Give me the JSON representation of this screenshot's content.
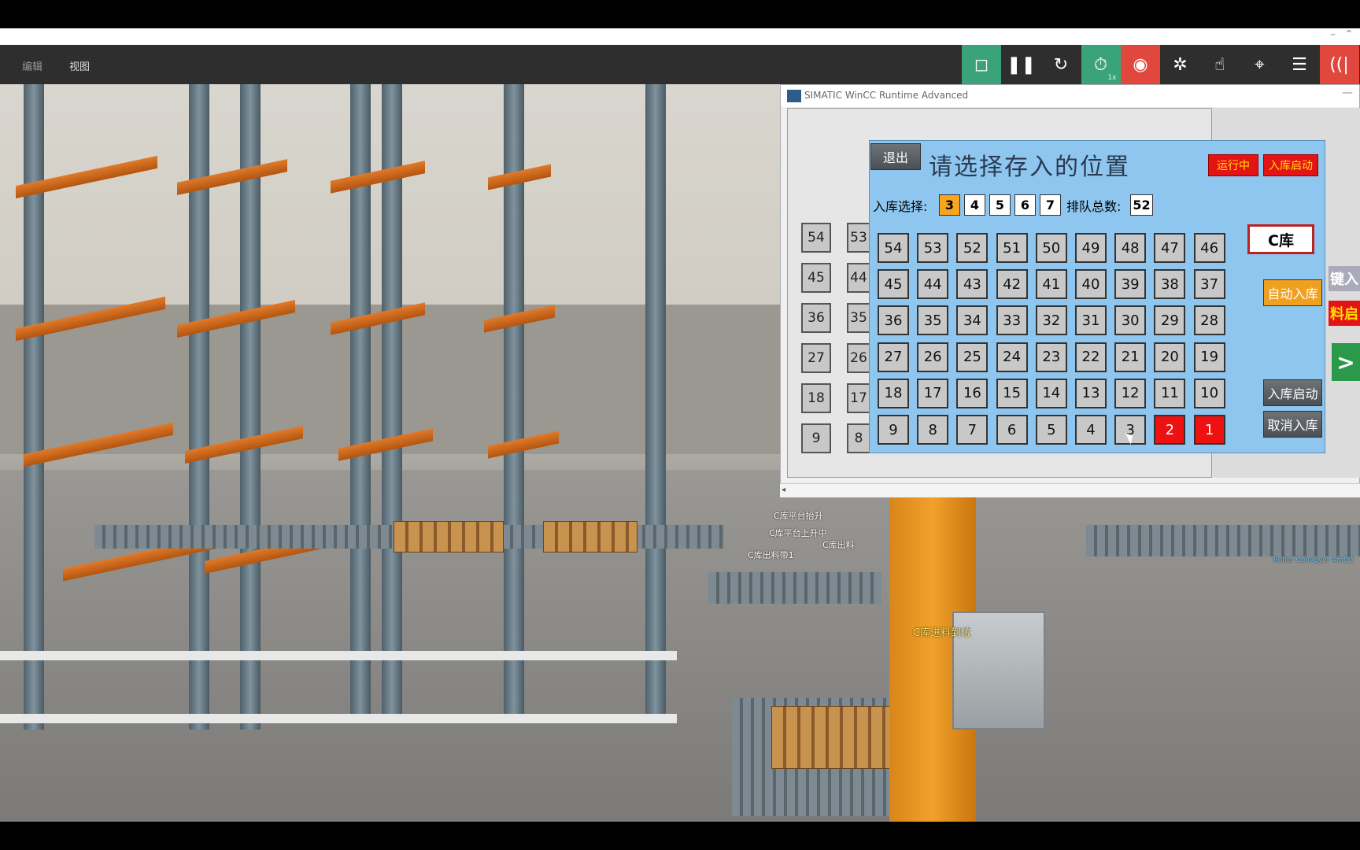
{
  "menu": {
    "edit": "编辑",
    "view": "视图"
  },
  "strip": {
    "minimize": "–",
    "collapse": "⌃"
  },
  "toolbar": {
    "buttons": [
      {
        "name": "stop",
        "glyph": "◻",
        "color": "#3aa37a"
      },
      {
        "name": "pause",
        "glyph": "❚❚",
        "color": "#2e2e2e"
      },
      {
        "name": "reset",
        "glyph": "↻",
        "color": "#2e2e2e"
      },
      {
        "name": "timer",
        "glyph": "⏱",
        "color": "#3aa37a",
        "sub": "1x"
      },
      {
        "name": "record",
        "glyph": "◉",
        "color": "#e0483e"
      },
      {
        "name": "fan",
        "glyph": "✲",
        "color": "#2e2e2e"
      },
      {
        "name": "touch",
        "glyph": "☝",
        "color": "#2e2e2e"
      },
      {
        "name": "target",
        "glyph": "⌖",
        "color": "#2e2e2e"
      },
      {
        "name": "list",
        "glyph": "☰",
        "color": "#2e2e2e"
      },
      {
        "name": "signal",
        "glyph": "((|",
        "color": "#e0483e"
      }
    ]
  },
  "wincc": {
    "title": "SIMATIC WinCC Runtime Advanced",
    "minimize": "—",
    "scroll_left": "◂",
    "background_cells": [
      "54",
      "53",
      "45",
      "44",
      "36",
      "35",
      "27",
      "26",
      "18",
      "17",
      "9",
      "8"
    ],
    "side_labels": {
      "enter": "键入",
      "material": "料启",
      "next": ">"
    }
  },
  "dialog": {
    "exit_label": "退出",
    "title": "请选择存入的位置",
    "status_running": "运行中",
    "status_inbound_start": "入库启动",
    "select_label": "入库选择:",
    "select_options": [
      "3",
      "4",
      "5",
      "6",
      "7"
    ],
    "selected_option": "3",
    "queue_label": "排队总数:",
    "queue_total": "52",
    "warehouse_label": "C库",
    "auto_inbound": "自动入库",
    "inbound_start": "入库启动",
    "cancel_inbound": "取消入库",
    "grid_rows": [
      [
        "54",
        "53",
        "52",
        "51",
        "50",
        "49",
        "48",
        "47",
        "46"
      ],
      [
        "45",
        "44",
        "43",
        "42",
        "41",
        "40",
        "39",
        "38",
        "37"
      ],
      [
        "36",
        "35",
        "34",
        "33",
        "32",
        "31",
        "30",
        "29",
        "28"
      ],
      [
        "27",
        "26",
        "25",
        "24",
        "23",
        "22",
        "21",
        "20",
        "19"
      ],
      [
        "18",
        "17",
        "16",
        "15",
        "14",
        "13",
        "12",
        "11",
        "10"
      ],
      [
        "9",
        "8",
        "7",
        "6",
        "5",
        "4",
        "3",
        "2",
        "1"
      ]
    ],
    "occupied_cells": [
      "2",
      "1"
    ]
  },
  "scene_labels": {
    "lift": "C库平台抬升",
    "platform_up": "C库平台上升中",
    "out_belt": "C库出料带1",
    "out_short": "C库出料",
    "arrived": "C库进料到位",
    "roller": "Roller Conveyor 4m(5)"
  }
}
